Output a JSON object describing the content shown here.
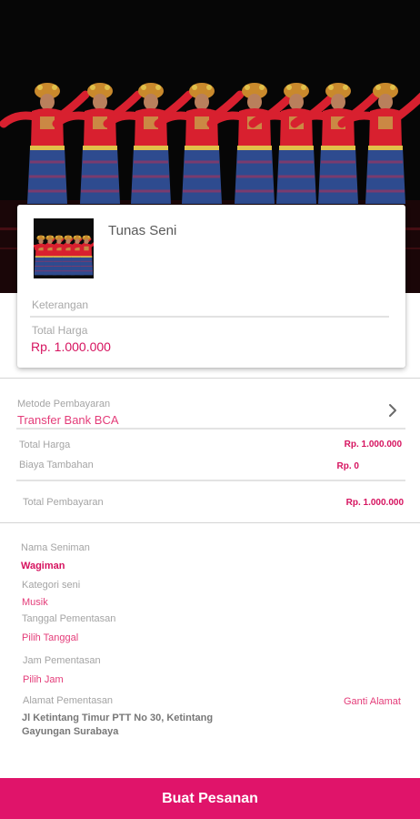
{
  "product": {
    "title": "Tunas Seni",
    "description_label": "Keterangan",
    "total_label": "Total Harga",
    "total_value": "Rp. 1.000.000"
  },
  "payment": {
    "method_label": "Metode Pembayaran",
    "method_value": "Transfer Bank BCA",
    "total_price_label": "Total Harga",
    "total_price_value": "Rp. 1.000.000",
    "extra_fee_label": "Biaya Tambahan",
    "extra_fee_value": "Rp. 0",
    "grand_total_label": "Total Pembayaran",
    "grand_total_value": "Rp. 1.000.000"
  },
  "artist": {
    "name_label": "Nama Seniman",
    "name_value": "Wagiman",
    "category_label": "Kategori seni",
    "category_value": "Musik",
    "date_label": "Tanggal Pementasan",
    "date_value": "Pilih Tanggal",
    "time_label": "Jam Pementasan",
    "time_value": "Pilih Jam",
    "address_label": "Alamat Pementasan",
    "change_address": "Ganti Alamat",
    "address_value": "Jl Ketintang Timur PTT No 30, Ketintang Gayungan Surabaya"
  },
  "footer": {
    "order_button": "Buat Pesanan"
  },
  "icons": {
    "chevron": "chevron-right-icon"
  },
  "colors": {
    "accent": "#e0146a",
    "accent_text": "#d6135f",
    "link": "#e43c79"
  }
}
